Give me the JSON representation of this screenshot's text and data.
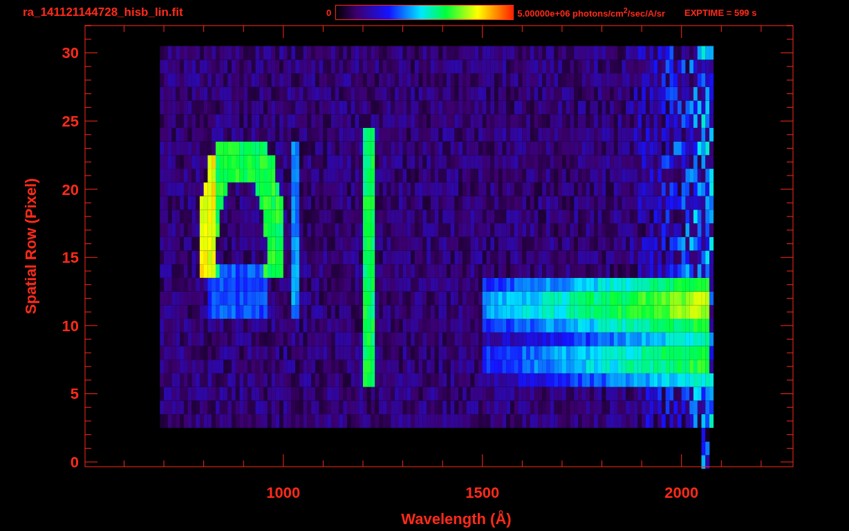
{
  "header": {
    "title": "ra_141121144728_hisb_lin.fit",
    "colorbar_min": "0",
    "colorbar_max": "5.00000e+06 photons/cm$^{2}$/sec/A/sr",
    "exptime": "EXPTIME = 599 s"
  },
  "plot": {
    "x_title": "Wavelength (Å)",
    "y_title": "Spatial Row (Pixel)",
    "y_ticks": [
      "30",
      "25",
      "20",
      "15",
      "10",
      "5",
      "0"
    ],
    "x_ticks": [
      "1000",
      "1500",
      "2000"
    ]
  }
}
